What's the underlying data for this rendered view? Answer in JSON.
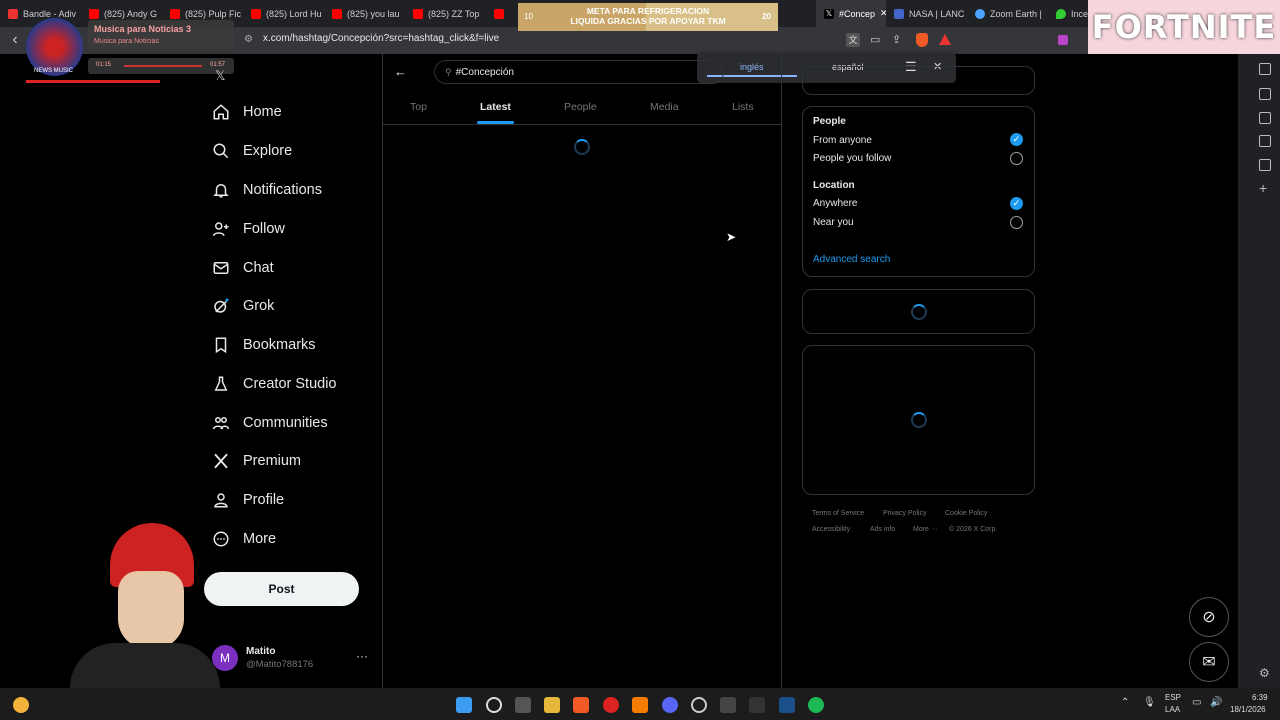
{
  "browser": {
    "tabs": [
      "Bandle - Adiv",
      "(825) Andy G",
      "(825) Pulp Fic",
      "(825) Lord Hu",
      "(825) you lau",
      "(825) ZZ Top",
      "#Concep",
      "NASA | LANC",
      "Zoom Earth |",
      "Incendio Trin"
    ],
    "url": "x.com/hashtag/Concepción?src=hashtag_click&f=live"
  },
  "overlay": {
    "music_title": "Musica para Noticias 3",
    "music_subtitle": "Musica para Noticias",
    "music_time_start": "01:15",
    "music_time_end": "01:57",
    "music_logo": "NEWS MUSIC",
    "donation_left": "10",
    "donation_text_1": "META PARA REFRIGERACION",
    "donation_text_2": "LIQUIDA GRACIAS POR APOYAR TKM",
    "donation_right": "20",
    "fortnite": "FORTNITE"
  },
  "translate": {
    "lang1": "inglés",
    "lang2": "español"
  },
  "nav": {
    "items": [
      "Home",
      "Explore",
      "Notifications",
      "Follow",
      "Chat",
      "Grok",
      "Bookmarks",
      "Creator Studio",
      "Communities",
      "Premium",
      "Profile",
      "More"
    ],
    "post": "Post",
    "user_name": "Matito",
    "user_handle": "@Matito788176",
    "avatar_letter": "M"
  },
  "search": {
    "query": "#Concepción"
  },
  "tabs": {
    "top": "Top",
    "latest": "Latest",
    "people": "People",
    "media": "Media",
    "lists": "Lists"
  },
  "filters": {
    "people_title": "People",
    "from_anyone": "From anyone",
    "people_you_follow": "People you follow",
    "location_title": "Location",
    "anywhere": "Anywhere",
    "near_you": "Near you",
    "advanced": "Advanced search"
  },
  "footer": {
    "terms": "Terms of Service",
    "privacy": "Privacy Policy",
    "cookie": "Cookie Policy",
    "accessibility": "Accessibility",
    "ads": "Ads info",
    "more": "More ···",
    "copyright": "© 2026 X Corp."
  },
  "taskbar": {
    "lang": "ESP",
    "lang2": "LAA",
    "time": "6:39",
    "date": "18/1/2026"
  },
  "colors": {
    "accent": "#1d9bf0",
    "bg": "#000000",
    "border": "#2f3336"
  }
}
